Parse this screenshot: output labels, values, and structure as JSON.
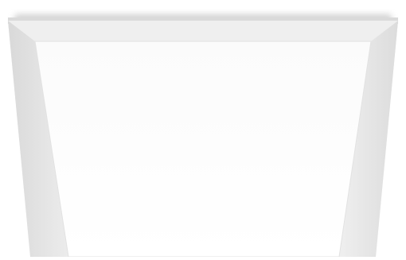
{
  "photo": {
    "subject_icon": "ceiling-panel-light-icon",
    "colors": {
      "background": "#ffffff",
      "frame": "#e9e9e9",
      "frame_shadow": "#cfcfcf",
      "panel": "#fdfdfd"
    }
  }
}
